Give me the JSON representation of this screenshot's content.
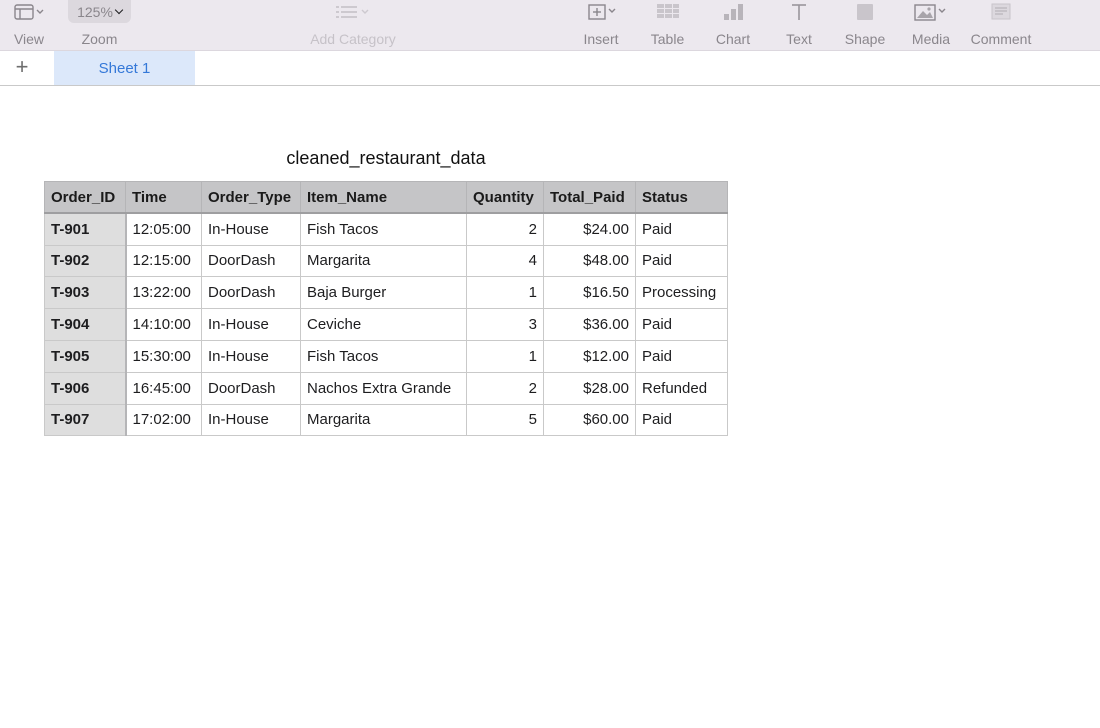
{
  "toolbar": {
    "view": {
      "label": "View",
      "icon": "sidebar-view-icon"
    },
    "zoom": {
      "label": "Zoom",
      "value": "125%"
    },
    "add_category": {
      "label": "Add Category",
      "icon": "list-icon"
    },
    "insert": {
      "label": "Insert",
      "icon": "insert-icon"
    },
    "table": {
      "label": "Table",
      "icon": "table-icon"
    },
    "chart": {
      "label": "Chart",
      "icon": "bar-chart-icon"
    },
    "text": {
      "label": "Text",
      "icon": "text-icon"
    },
    "shape": {
      "label": "Shape",
      "icon": "shape-icon"
    },
    "media": {
      "label": "Media",
      "icon": "image-icon"
    },
    "comment": {
      "label": "Comment",
      "icon": "comment-icon"
    }
  },
  "tabs": {
    "add_icon": "plus-icon",
    "sheets": [
      {
        "label": "Sheet 1",
        "active": true
      }
    ]
  },
  "table": {
    "title": "cleaned_restaurant_data",
    "columns": [
      "Order_ID",
      "Time",
      "Order_Type",
      "Item_Name",
      "Quantity",
      "Total_Paid",
      "Status"
    ],
    "rows": [
      [
        "T-901",
        "12:05:00",
        "In-House",
        "Fish Tacos",
        "2",
        "$24.00",
        "Paid"
      ],
      [
        "T-902",
        "12:15:00",
        "DoorDash",
        "Margarita",
        "4",
        "$48.00",
        "Paid"
      ],
      [
        "T-903",
        "13:22:00",
        "DoorDash",
        "Baja Burger",
        "1",
        "$16.50",
        "Processing"
      ],
      [
        "T-904",
        "14:10:00",
        "In-House",
        "Ceviche",
        "3",
        "$36.00",
        "Paid"
      ],
      [
        "T-905",
        "15:30:00",
        "In-House",
        "Fish Tacos",
        "1",
        "$12.00",
        "Paid"
      ],
      [
        "T-906",
        "16:45:00",
        "DoorDash",
        "Nachos Extra Grande",
        "2",
        "$28.00",
        "Refunded"
      ],
      [
        "T-907",
        "17:02:00",
        "In-House",
        "Margarita",
        "5",
        "$60.00",
        "Paid"
      ]
    ]
  },
  "colors": {
    "accent": "#3478d8",
    "toolbar_bg": "#ece8ee",
    "header_bg": "#c5c5c7",
    "rowhead_bg": "#dedede"
  }
}
